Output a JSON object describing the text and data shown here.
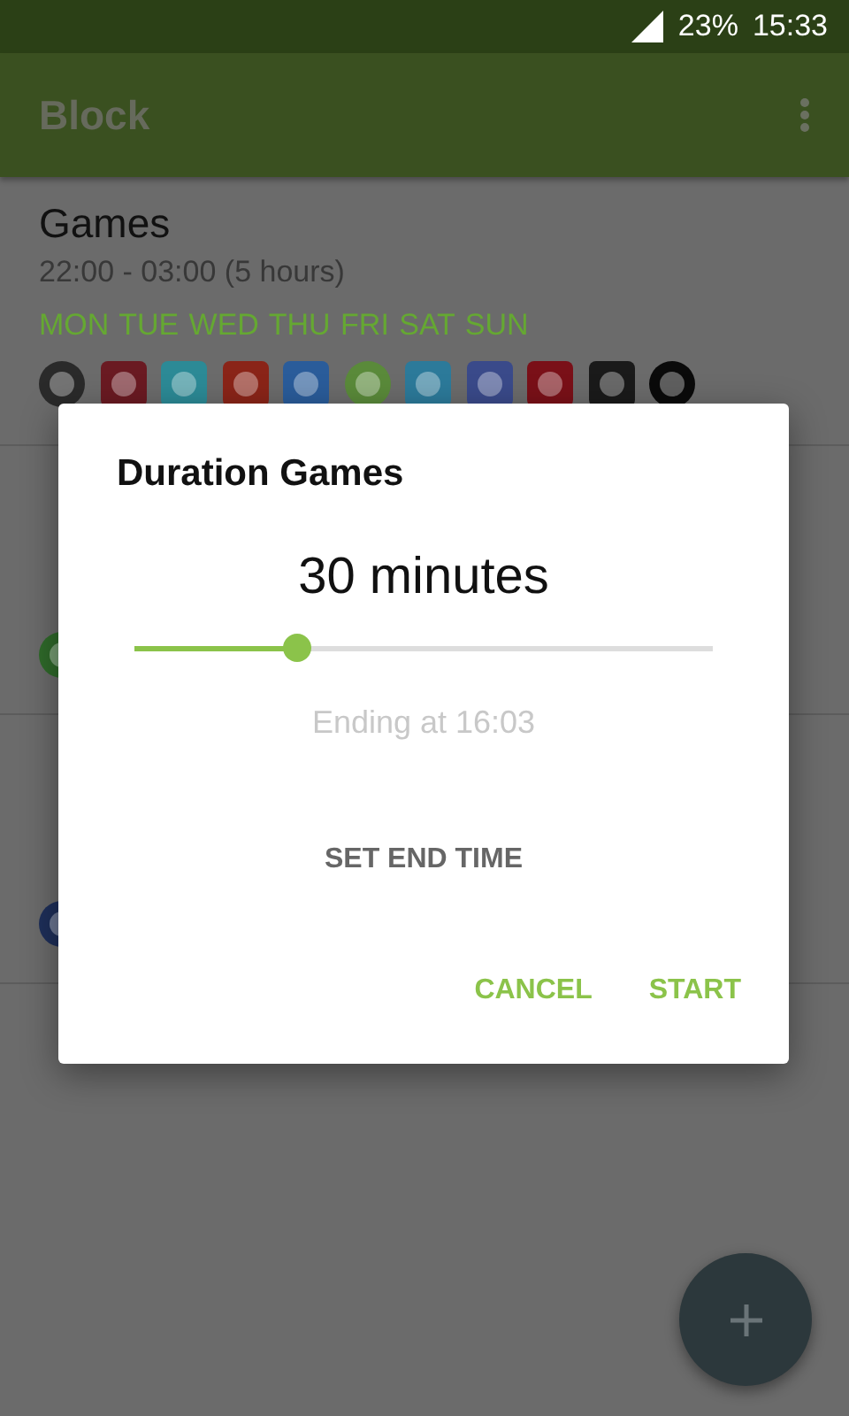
{
  "status_bar": {
    "battery": "23%",
    "time": "15:33"
  },
  "app_bar": {
    "title": "Block"
  },
  "schedules": [
    {
      "name": "Games",
      "time": "22:00 - 03:00 (5 hours)",
      "days": "MON TUE WED THU FRI SAT SUN",
      "apps": [
        {
          "kind": "picture"
        },
        {
          "kind": "picture"
        },
        {
          "kind": "picture"
        },
        {
          "kind": "picture"
        },
        {
          "kind": "picture"
        },
        {
          "kind": "picture"
        },
        {
          "kind": "picture"
        },
        {
          "kind": "picture"
        },
        {
          "kind": "picture"
        },
        {
          "kind": "picture"
        },
        {
          "kind": "picture"
        }
      ]
    },
    {
      "apps": [
        {
          "kind": "picture"
        }
      ]
    },
    {
      "apps": [
        {
          "kind": "picture"
        }
      ]
    }
  ],
  "dialog": {
    "title": "Duration Games",
    "duration": "30 minutes",
    "level": 0.28,
    "ending": "Ending at 16:03",
    "set_end": "SET END TIME",
    "buttons": [
      "CANCEL",
      "START"
    ]
  }
}
